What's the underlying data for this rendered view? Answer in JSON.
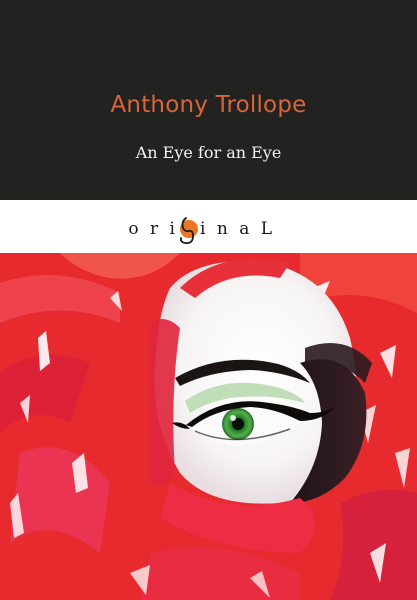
{
  "author": "Anthony Trollope",
  "title": "An Eye for an Eye",
  "series": {
    "letters_left": "o r i",
    "letters_right": "i n a L"
  },
  "colors": {
    "background_dark": "#222220",
    "author_orange": "#d9653a",
    "title_white": "#f2f2f2",
    "scarf_red": "#e62a2e",
    "eye_green": "#3a9a3a",
    "series_orange": "#e87722"
  },
  "icons": {
    "series_logo_mark": "orange-circle-g-icon"
  }
}
